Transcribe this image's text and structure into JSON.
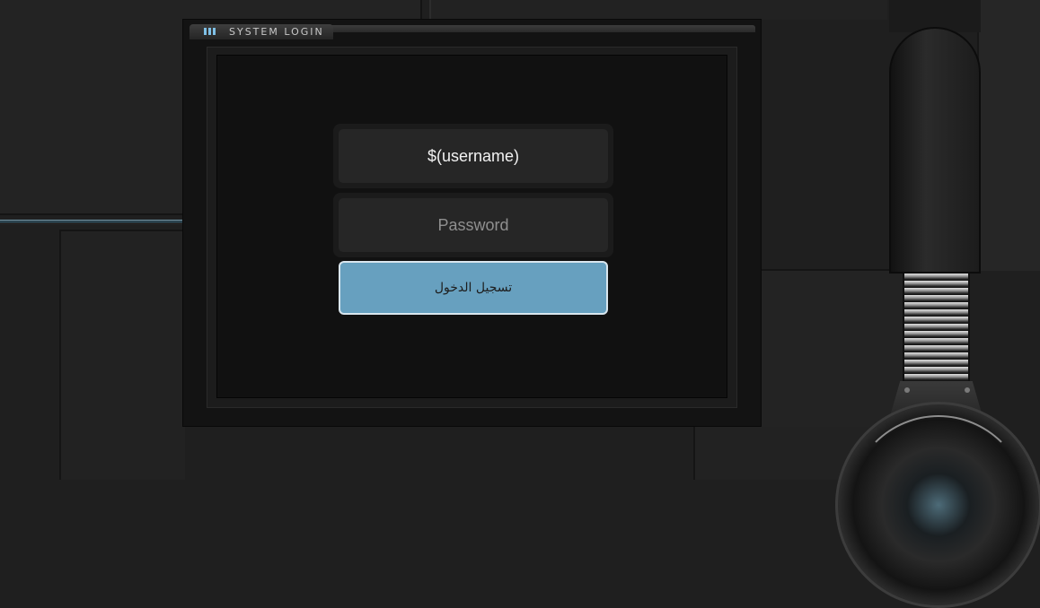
{
  "window": {
    "title": "SYSTEM LOGIN",
    "title_icon": "bars-icon"
  },
  "form": {
    "username_value": "$(username)",
    "password_placeholder": "Password",
    "submit_label": "تسجيل الدخول"
  },
  "colors": {
    "accent": "#67a0bf",
    "background": "#1f1f1f",
    "screen": "#111111"
  }
}
